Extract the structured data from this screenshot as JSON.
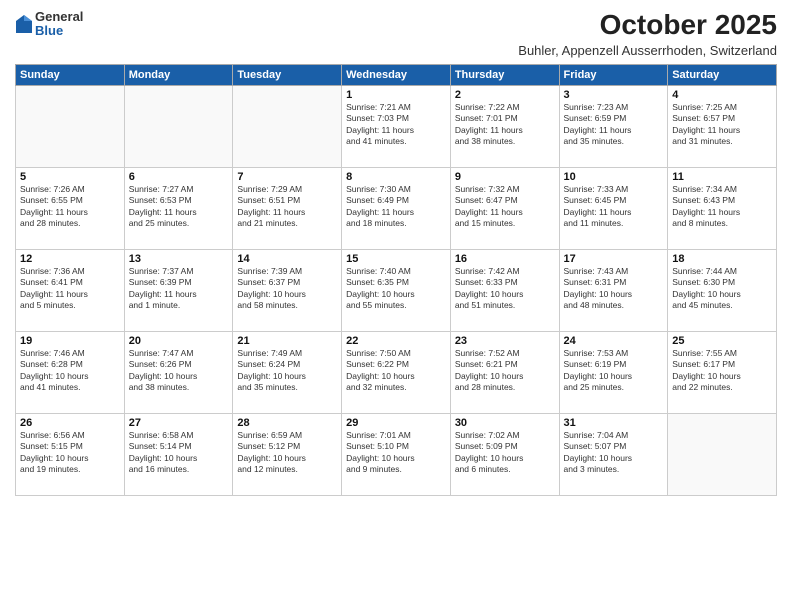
{
  "logo": {
    "general": "General",
    "blue": "Blue"
  },
  "title": "October 2025",
  "subtitle": "Buhler, Appenzell Ausserrhoden, Switzerland",
  "weekdays": [
    "Sunday",
    "Monday",
    "Tuesday",
    "Wednesday",
    "Thursday",
    "Friday",
    "Saturday"
  ],
  "weeks": [
    [
      {
        "day": "",
        "info": ""
      },
      {
        "day": "",
        "info": ""
      },
      {
        "day": "",
        "info": ""
      },
      {
        "day": "1",
        "info": "Sunrise: 7:21 AM\nSunset: 7:03 PM\nDaylight: 11 hours\nand 41 minutes."
      },
      {
        "day": "2",
        "info": "Sunrise: 7:22 AM\nSunset: 7:01 PM\nDaylight: 11 hours\nand 38 minutes."
      },
      {
        "day": "3",
        "info": "Sunrise: 7:23 AM\nSunset: 6:59 PM\nDaylight: 11 hours\nand 35 minutes."
      },
      {
        "day": "4",
        "info": "Sunrise: 7:25 AM\nSunset: 6:57 PM\nDaylight: 11 hours\nand 31 minutes."
      }
    ],
    [
      {
        "day": "5",
        "info": "Sunrise: 7:26 AM\nSunset: 6:55 PM\nDaylight: 11 hours\nand 28 minutes."
      },
      {
        "day": "6",
        "info": "Sunrise: 7:27 AM\nSunset: 6:53 PM\nDaylight: 11 hours\nand 25 minutes."
      },
      {
        "day": "7",
        "info": "Sunrise: 7:29 AM\nSunset: 6:51 PM\nDaylight: 11 hours\nand 21 minutes."
      },
      {
        "day": "8",
        "info": "Sunrise: 7:30 AM\nSunset: 6:49 PM\nDaylight: 11 hours\nand 18 minutes."
      },
      {
        "day": "9",
        "info": "Sunrise: 7:32 AM\nSunset: 6:47 PM\nDaylight: 11 hours\nand 15 minutes."
      },
      {
        "day": "10",
        "info": "Sunrise: 7:33 AM\nSunset: 6:45 PM\nDaylight: 11 hours\nand 11 minutes."
      },
      {
        "day": "11",
        "info": "Sunrise: 7:34 AM\nSunset: 6:43 PM\nDaylight: 11 hours\nand 8 minutes."
      }
    ],
    [
      {
        "day": "12",
        "info": "Sunrise: 7:36 AM\nSunset: 6:41 PM\nDaylight: 11 hours\nand 5 minutes."
      },
      {
        "day": "13",
        "info": "Sunrise: 7:37 AM\nSunset: 6:39 PM\nDaylight: 11 hours\nand 1 minute."
      },
      {
        "day": "14",
        "info": "Sunrise: 7:39 AM\nSunset: 6:37 PM\nDaylight: 10 hours\nand 58 minutes."
      },
      {
        "day": "15",
        "info": "Sunrise: 7:40 AM\nSunset: 6:35 PM\nDaylight: 10 hours\nand 55 minutes."
      },
      {
        "day": "16",
        "info": "Sunrise: 7:42 AM\nSunset: 6:33 PM\nDaylight: 10 hours\nand 51 minutes."
      },
      {
        "day": "17",
        "info": "Sunrise: 7:43 AM\nSunset: 6:31 PM\nDaylight: 10 hours\nand 48 minutes."
      },
      {
        "day": "18",
        "info": "Sunrise: 7:44 AM\nSunset: 6:30 PM\nDaylight: 10 hours\nand 45 minutes."
      }
    ],
    [
      {
        "day": "19",
        "info": "Sunrise: 7:46 AM\nSunset: 6:28 PM\nDaylight: 10 hours\nand 41 minutes."
      },
      {
        "day": "20",
        "info": "Sunrise: 7:47 AM\nSunset: 6:26 PM\nDaylight: 10 hours\nand 38 minutes."
      },
      {
        "day": "21",
        "info": "Sunrise: 7:49 AM\nSunset: 6:24 PM\nDaylight: 10 hours\nand 35 minutes."
      },
      {
        "day": "22",
        "info": "Sunrise: 7:50 AM\nSunset: 6:22 PM\nDaylight: 10 hours\nand 32 minutes."
      },
      {
        "day": "23",
        "info": "Sunrise: 7:52 AM\nSunset: 6:21 PM\nDaylight: 10 hours\nand 28 minutes."
      },
      {
        "day": "24",
        "info": "Sunrise: 7:53 AM\nSunset: 6:19 PM\nDaylight: 10 hours\nand 25 minutes."
      },
      {
        "day": "25",
        "info": "Sunrise: 7:55 AM\nSunset: 6:17 PM\nDaylight: 10 hours\nand 22 minutes."
      }
    ],
    [
      {
        "day": "26",
        "info": "Sunrise: 6:56 AM\nSunset: 5:15 PM\nDaylight: 10 hours\nand 19 minutes."
      },
      {
        "day": "27",
        "info": "Sunrise: 6:58 AM\nSunset: 5:14 PM\nDaylight: 10 hours\nand 16 minutes."
      },
      {
        "day": "28",
        "info": "Sunrise: 6:59 AM\nSunset: 5:12 PM\nDaylight: 10 hours\nand 12 minutes."
      },
      {
        "day": "29",
        "info": "Sunrise: 7:01 AM\nSunset: 5:10 PM\nDaylight: 10 hours\nand 9 minutes."
      },
      {
        "day": "30",
        "info": "Sunrise: 7:02 AM\nSunset: 5:09 PM\nDaylight: 10 hours\nand 6 minutes."
      },
      {
        "day": "31",
        "info": "Sunrise: 7:04 AM\nSunset: 5:07 PM\nDaylight: 10 hours\nand 3 minutes."
      },
      {
        "day": "",
        "info": ""
      }
    ]
  ]
}
